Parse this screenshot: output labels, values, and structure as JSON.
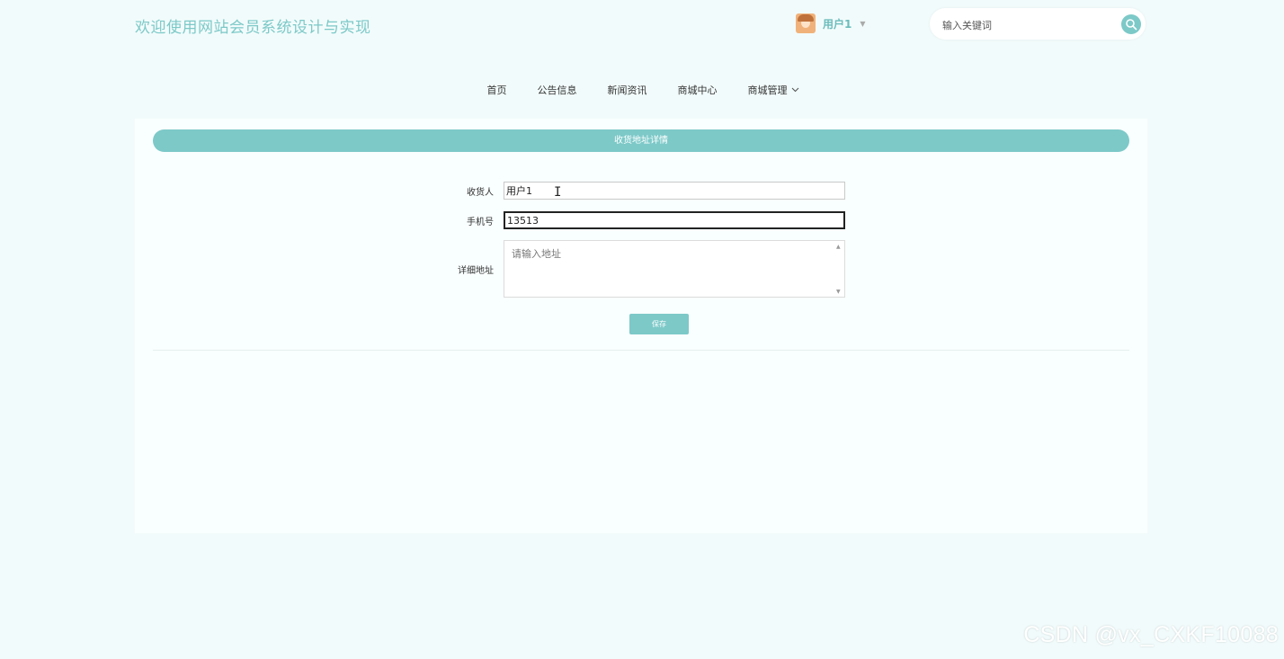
{
  "header": {
    "site_title": "欢迎使用网站会员系统设计与实现",
    "user_name": "用户1",
    "user_caret": "▼",
    "search_placeholder": "输入关键词"
  },
  "nav": {
    "items": [
      "首页",
      "公告信息",
      "新闻资讯",
      "商城中心",
      "商城管理"
    ]
  },
  "panel": {
    "title": "收货地址详情"
  },
  "form": {
    "receiver_label": "收货人",
    "receiver_value": "用户1",
    "phone_label": "手机号",
    "phone_value": "13513",
    "address_label": "详细地址",
    "address_placeholder": "请输入地址",
    "save_label": "保存"
  },
  "watermark": "CSDN @vx_CXKF10088",
  "colors": {
    "accent": "#7cc9c8",
    "background": "#f2fbfb"
  },
  "icons": {
    "search": "search-icon",
    "dropdown": "chevron-down-icon",
    "avatar": "avatar-icon",
    "cursor": "text-cursor-icon"
  }
}
